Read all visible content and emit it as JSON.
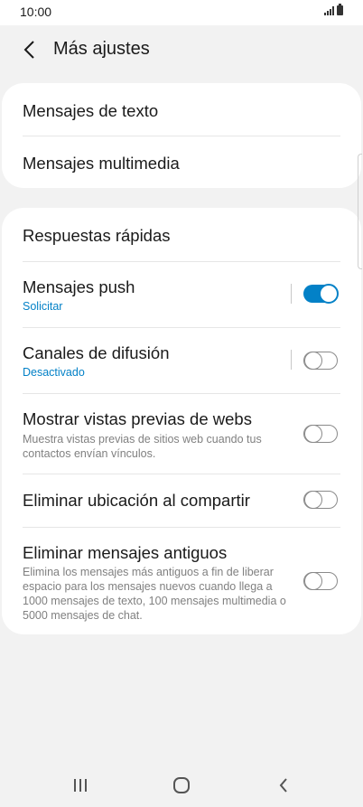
{
  "status_bar": {
    "time": "10:00"
  },
  "header": {
    "title": "Más ajustes"
  },
  "group1": {
    "items": [
      {
        "title": "Mensajes de texto"
      },
      {
        "title": "Mensajes multimedia"
      }
    ]
  },
  "group2": {
    "quick_replies": {
      "title": "Respuestas rápidas"
    },
    "push": {
      "title": "Mensajes push",
      "subtitle": "Solicitar",
      "enabled": true
    },
    "broadcast": {
      "title": "Canales de difusión",
      "subtitle": "Desactivado",
      "enabled": false
    },
    "web_preview": {
      "title": "Mostrar vistas previas de webs",
      "description": "Muestra vistas previas de sitios web cuando tus contactos envían vínculos.",
      "enabled": false
    },
    "remove_location": {
      "title": "Eliminar ubicación al compartir",
      "enabled": false
    },
    "delete_old": {
      "title": "Eliminar mensajes antiguos",
      "description": "Elimina los mensajes más antiguos a fin de liberar espacio para los mensajes nuevos cuando llega a 1000 mensajes de texto, 100 mensajes multimedia o 5000 mensajes de chat.",
      "enabled": false
    }
  },
  "colors": {
    "accent": "#0381c7",
    "background": "#f2f2f2",
    "card": "#ffffff"
  },
  "icons": {
    "back": "back-arrow-icon",
    "recents": "recents-icon",
    "home": "home-icon",
    "nav_back": "nav-back-icon"
  }
}
